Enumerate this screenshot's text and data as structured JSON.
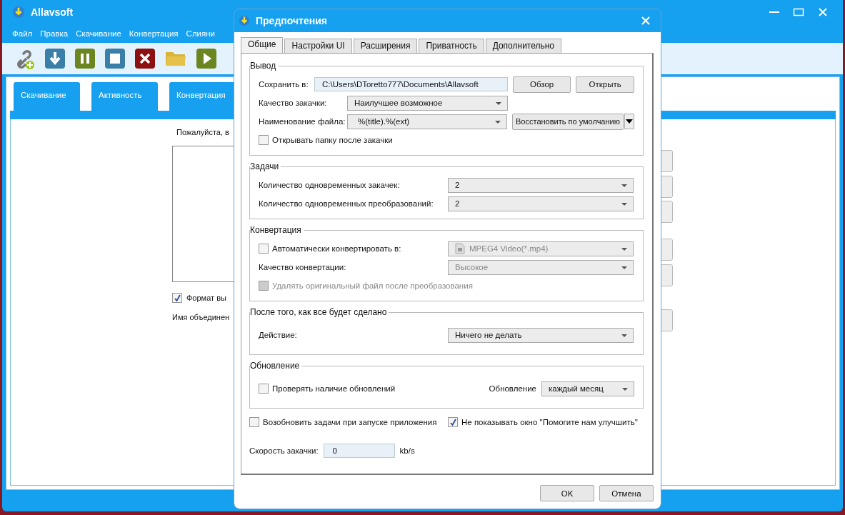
{
  "app": {
    "title": "Allavsoft",
    "menu": [
      "Файл",
      "Правка",
      "Скачивание",
      "Конвертация",
      "Слияни"
    ],
    "toolbar": [
      {
        "kind": "link"
      },
      {
        "kind": "download"
      },
      {
        "kind": "pause"
      },
      {
        "kind": "stop"
      },
      {
        "kind": "delete"
      },
      {
        "kind": "folder"
      },
      {
        "kind": "play"
      }
    ],
    "tabs": [
      "Скачивание",
      "Активность",
      "Конвертация"
    ],
    "content": {
      "prompt": "Пожалуйста, в",
      "format_checkbox": {
        "label": "Формат вы",
        "checked": true
      },
      "merge_label": "Имя объединен"
    }
  },
  "dialog": {
    "title": "Предпочтения",
    "tabs": [
      {
        "label": "Общие",
        "selected": true
      },
      {
        "label": "Настройки UI",
        "selected": false
      },
      {
        "label": "Расширения",
        "selected": false
      },
      {
        "label": "Приватность",
        "selected": false
      },
      {
        "label": "Дополнительно",
        "selected": false
      }
    ],
    "output": {
      "title": "Вывод",
      "save_label": "Сохранить в:",
      "save_path": "C:\\Users\\DToretto777\\Documents\\Allavsoft",
      "browse": "Обзор",
      "open": "Открыть",
      "quality_label": "Качество закачки:",
      "quality": "Наилучшее возможное",
      "naming_label": "Наименование файла:",
      "naming": "%(title).%(ext)",
      "restore": "Восстановить по умолчанию",
      "open_folder": {
        "label": "Открывать папку после закачки",
        "checked": false
      }
    },
    "tasks": {
      "title": "Задачи",
      "rows": [
        {
          "label": "Количество одновременных закачек:",
          "value": "2"
        },
        {
          "label": "Количество одновременных преобразований:",
          "value": "2"
        }
      ]
    },
    "conversion": {
      "title": "Конвертация",
      "auto": {
        "label": "Автоматически конвертировать в:",
        "checked": false
      },
      "format": "MPEG4 Video(*.mp4)",
      "format_disabled": true,
      "quality_label": "Качество конвертации:",
      "quality": "Высокое",
      "quality_disabled": true,
      "delete_original": {
        "label": "Удалять оригинальный файл после преобразования",
        "checked": false,
        "disabled": true
      }
    },
    "after": {
      "title": "После того, как все будет сделано",
      "action_label": "Действие:",
      "action": "Ничего не делать"
    },
    "update": {
      "title": "Обновление",
      "check": {
        "label": "Проверять наличие обновлений",
        "checked": false
      },
      "freq_label": "Обновление",
      "freq": "каждый месяц"
    },
    "resume": {
      "label": "Возобновить задачи при запуске приложения",
      "checked": false
    },
    "no_help": {
      "label": "Не показывать окно \"Помогите нам улучшить\"",
      "checked": true
    },
    "speed_label": "Скорость закачки:",
    "speed": "0",
    "speed_unit": "kb/s",
    "ok": "OK",
    "cancel": "Отмена"
  }
}
